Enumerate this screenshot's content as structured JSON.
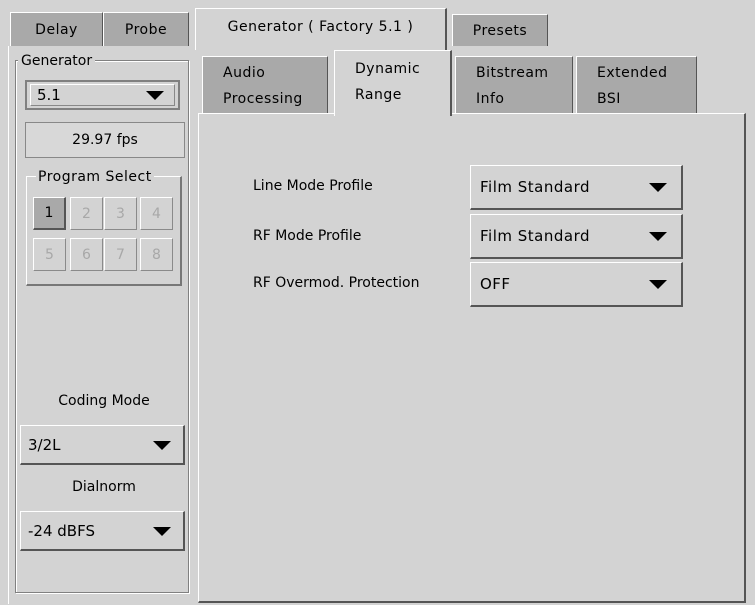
{
  "top_tabs": [
    {
      "label": "Delay"
    },
    {
      "label": "Probe"
    },
    {
      "label": "Generator ( Factory 5.1 )"
    },
    {
      "label": "Presets"
    }
  ],
  "sidebar": {
    "group_label": "Generator",
    "generator_select": {
      "value": "5.1"
    },
    "frame_rate": "29.97 fps",
    "program_select": {
      "label": "Program Select",
      "buttons": [
        "1",
        "2",
        "3",
        "4",
        "5",
        "6",
        "7",
        "8"
      ],
      "active": "1"
    },
    "coding_mode": {
      "label": "Coding Mode",
      "value": "3/2L"
    },
    "dialnorm": {
      "label": "Dialnorm",
      "value": "-24 dBFS"
    }
  },
  "sub_tabs": [
    {
      "line1": "Audio",
      "line2": "Processing"
    },
    {
      "line1": "Dynamic",
      "line2": "Range"
    },
    {
      "line1": "Bitstream",
      "line2": "Info"
    },
    {
      "line1": "Extended",
      "line2": "BSI"
    }
  ],
  "dynamic_range": {
    "rows": [
      {
        "label": "Line Mode Profile",
        "value": "Film Standard"
      },
      {
        "label": "RF Mode Profile",
        "value": "Film Standard"
      },
      {
        "label": "RF Overmod. Protection",
        "value": "OFF"
      }
    ]
  },
  "colors": {
    "panel": "#d3d3d3",
    "tab_inactive": "#a9a9a9",
    "shadow": "#555555",
    "highlight": "#ffffff"
  }
}
